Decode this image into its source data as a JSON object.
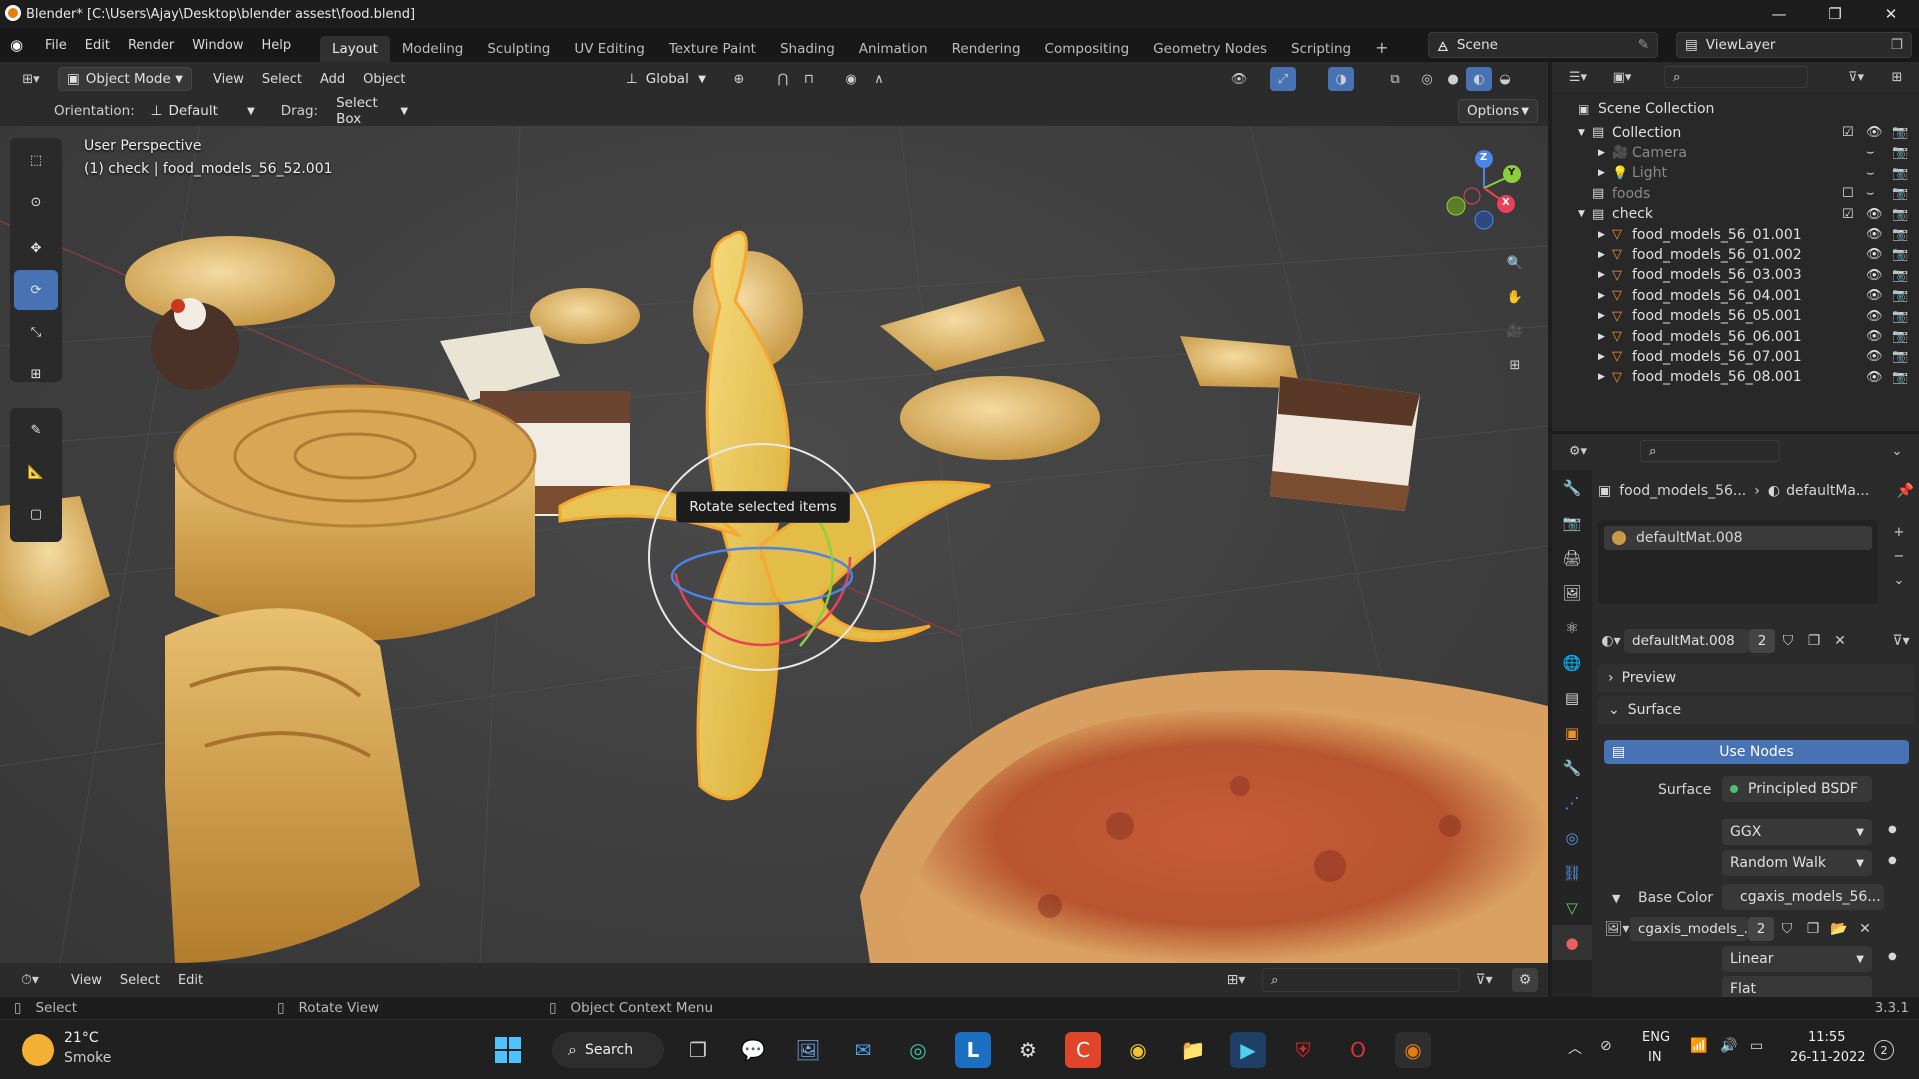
{
  "window": {
    "title": "Blender* [C:\\Users\\Ajay\\Desktop\\blender assest\\food.blend]",
    "minimize": "—",
    "maximize": "❐",
    "close": "✕"
  },
  "menubar": {
    "items": [
      "File",
      "Edit",
      "Render",
      "Window",
      "Help"
    ]
  },
  "workspaces": {
    "tabs": [
      "Layout",
      "Modeling",
      "Sculpting",
      "UV Editing",
      "Texture Paint",
      "Shading",
      "Animation",
      "Rendering",
      "Compositing",
      "Geometry Nodes",
      "Scripting"
    ],
    "active": "Layout",
    "add": "+"
  },
  "scene": {
    "label": "Scene",
    "view_layer": "ViewLayer"
  },
  "header": {
    "mode": "Object Mode",
    "menus": [
      "View",
      "Select",
      "Add",
      "Object"
    ],
    "transform": "Global",
    "orientation_label": "Orientation:",
    "orientation_value": "Default",
    "drag_label": "Drag:",
    "drag_value": "Select Box",
    "options": "Options"
  },
  "viewport": {
    "perspective": "User Perspective",
    "object_info": "(1) check | food_models_56_52.001",
    "tooltip": "Rotate selected items",
    "gizmo": {
      "z": "Z",
      "y": "Y",
      "x": "X"
    }
  },
  "outliner": {
    "scene_collection": "Scene Collection",
    "rows": [
      {
        "label": "Collection",
        "level": 1,
        "type": "collection",
        "visible": true
      },
      {
        "label": "Camera",
        "level": 2,
        "type": "camera",
        "visible": false
      },
      {
        "label": "Light",
        "level": 2,
        "type": "light",
        "visible": false
      },
      {
        "label": "foods",
        "level": 1,
        "type": "collection",
        "visible": false
      },
      {
        "label": "check",
        "level": 1,
        "type": "collection",
        "visible": true
      },
      {
        "label": "food_models_56_01.001",
        "level": 2,
        "type": "mesh",
        "visible": true
      },
      {
        "label": "food_models_56_01.002",
        "level": 2,
        "type": "mesh",
        "visible": true
      },
      {
        "label": "food_models_56_03.003",
        "level": 2,
        "type": "mesh",
        "visible": true
      },
      {
        "label": "food_models_56_04.001",
        "level": 2,
        "type": "mesh",
        "visible": true
      },
      {
        "label": "food_models_56_05.001",
        "level": 2,
        "type": "mesh",
        "visible": true
      },
      {
        "label": "food_models_56_06.001",
        "level": 2,
        "type": "mesh",
        "visible": true
      },
      {
        "label": "food_models_56_07.001",
        "level": 2,
        "type": "mesh",
        "visible": true
      },
      {
        "label": "food_models_56_08.001",
        "level": 2,
        "type": "mesh",
        "visible": true
      }
    ]
  },
  "properties": {
    "breadcrumb_object": "food_models_56...",
    "breadcrumb_material": "defaultMa...",
    "slot": "defaultMat.008",
    "material_name": "defaultMat.008",
    "users": "2",
    "sections": {
      "preview": "Preview",
      "surface": "Surface"
    },
    "use_nodes": "Use Nodes",
    "surface_label": "Surface",
    "surface_value": "Principled BSDF",
    "distribution": "GGX",
    "subsurface": "Random Walk",
    "base_color_label": "Base Color",
    "base_color_value": "cgaxis_models_56...",
    "image_name": "cgaxis_models_...",
    "image_users": "2",
    "interpolation": "Linear",
    "projection": "Flat"
  },
  "timeline": {
    "menus": [
      "View",
      "Select",
      "Edit"
    ]
  },
  "statusbar": {
    "select": "Select",
    "rotate": "Rotate View",
    "context": "Object Context Menu",
    "version": "3.3.1"
  },
  "taskbar": {
    "temperature": "21°C",
    "weather": "Smoke",
    "search": "Search",
    "lang1": "ENG",
    "lang2": "IN",
    "time": "11:55",
    "date": "26-11-2022",
    "notif": "2"
  },
  "colors": {
    "accent": "#4772b3",
    "selection": "#f5a830",
    "axis_x": "#e8425a",
    "axis_y": "#8ccf3c",
    "axis_z": "#4a85e8"
  }
}
